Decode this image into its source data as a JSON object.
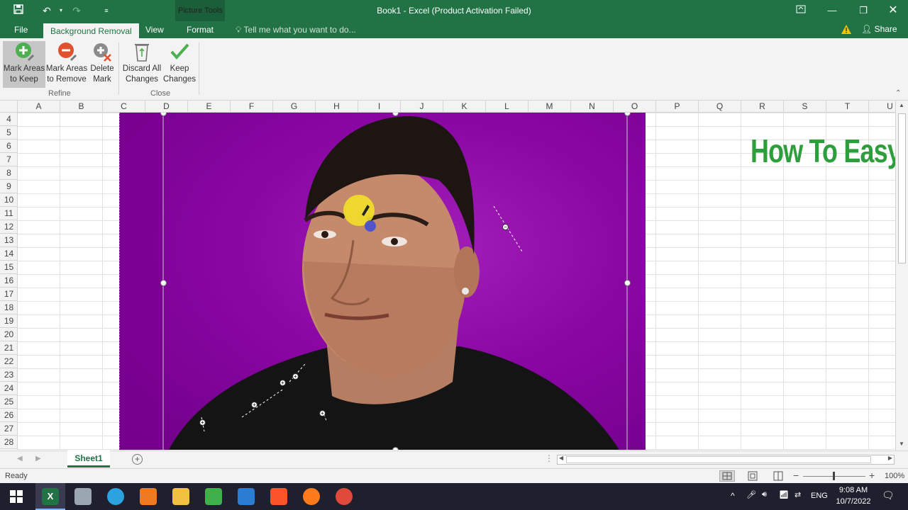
{
  "window": {
    "title": "Book1 - Excel (Product Activation Failed)",
    "context_group": "Picture Tools",
    "accent": "#217346"
  },
  "tabs": {
    "file": "File",
    "background_removal": "Background Removal",
    "view": "View",
    "format": "Format",
    "tell_me": "Tell me what you want to do...",
    "share": "Share"
  },
  "ribbon": {
    "mark_keep_line1": "Mark Areas",
    "mark_keep_line2": "to Keep",
    "mark_remove_line1": "Mark Areas",
    "mark_remove_line2": "to Remove",
    "delete_mark_line1": "Delete",
    "delete_mark_line2": "Mark",
    "discard_line1": "Discard All",
    "discard_line2": "Changes",
    "keep_line1": "Keep",
    "keep_line2": "Changes",
    "group_refine": "Refine",
    "group_close": "Close"
  },
  "columns": [
    "A",
    "B",
    "C",
    "D",
    "E",
    "F",
    "G",
    "H",
    "I",
    "J",
    "K",
    "L",
    "M",
    "N",
    "O",
    "P",
    "Q",
    "R",
    "S",
    "T",
    "U"
  ],
  "rows": [
    "4",
    "5",
    "6",
    "7",
    "8",
    "9",
    "10",
    "11",
    "12",
    "13",
    "14",
    "15",
    "16",
    "17",
    "18",
    "19",
    "20",
    "21",
    "22",
    "23",
    "24",
    "25",
    "26",
    "27",
    "28"
  ],
  "watermark": "How To Easy",
  "sheet": {
    "tab": "Sheet1"
  },
  "status": {
    "ready": "Ready",
    "zoom": "100%"
  },
  "tray": {
    "lang": "ENG",
    "time": "9:08 AM",
    "date": "10/7/2022"
  }
}
